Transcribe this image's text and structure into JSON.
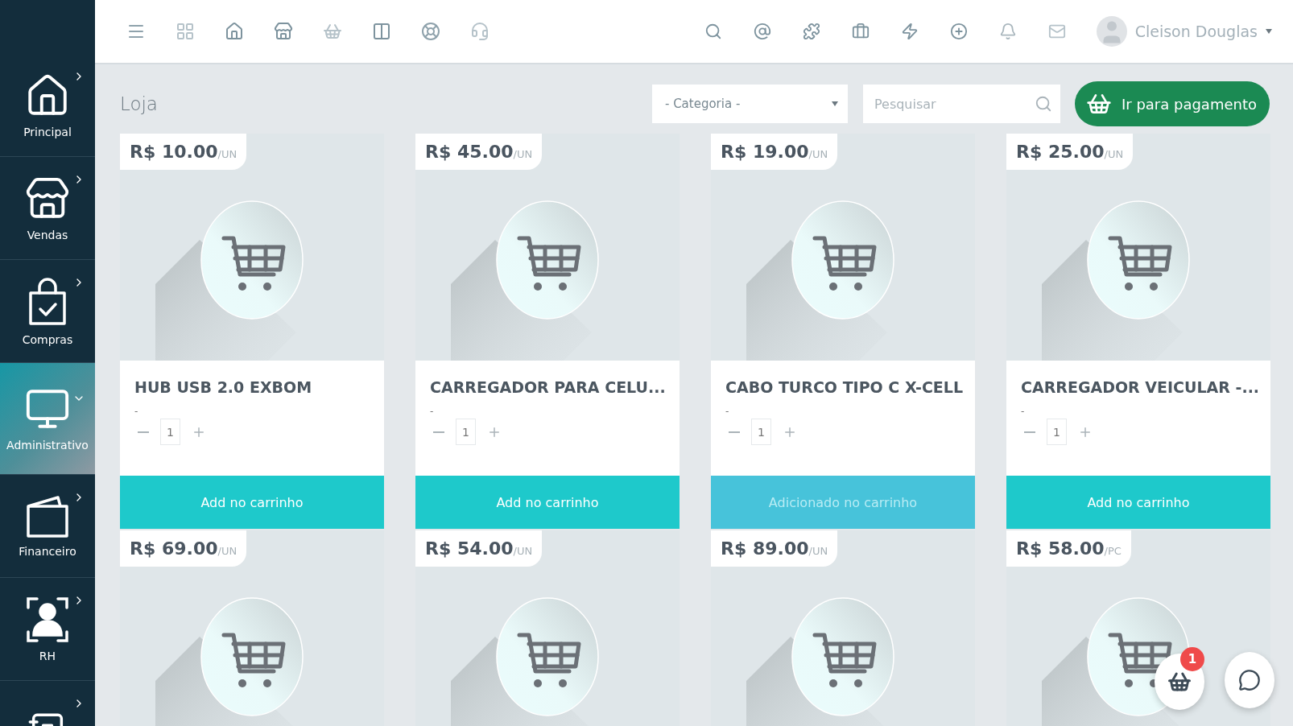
{
  "sidebar": {
    "items": [
      {
        "label": "Principal",
        "selected": false,
        "expanded": false
      },
      {
        "label": "Vendas",
        "selected": false,
        "expanded": false
      },
      {
        "label": "Compras",
        "selected": false,
        "expanded": false
      },
      {
        "label": "Administrativo",
        "selected": true,
        "expanded": true
      },
      {
        "label": "Financeiro",
        "selected": false,
        "expanded": false
      },
      {
        "label": "RH",
        "selected": false,
        "expanded": false
      },
      {
        "selected": false,
        "expanded": false
      }
    ]
  },
  "topbar": {
    "user": {
      "name": "Cleison Douglas"
    }
  },
  "page": {
    "title": "Loja",
    "category_select": {
      "value": "- Categoria -"
    },
    "search": {
      "placeholder": "Pesquisar"
    },
    "checkout_button": "Ir para pagamento"
  },
  "products": [
    {
      "price": "R$ 10.00",
      "unit": "/UN",
      "name": "HUB USB 2.0 EXBOM",
      "description": "-",
      "quantity": "1",
      "button": "Add no carrinho",
      "added": false
    },
    {
      "price": "R$ 45.00",
      "unit": "/UN",
      "name": "CARREGADOR PARA CELU...",
      "description": "-",
      "quantity": "1",
      "button": "Add no carrinho",
      "added": false
    },
    {
      "price": "R$ 19.00",
      "unit": "/UN",
      "name": "CABO TURCO TIPO C X-CELL",
      "description": "-",
      "quantity": "1",
      "button": "Adicionado no carrinho",
      "added": true
    },
    {
      "price": "R$ 25.00",
      "unit": "/UN",
      "name": "CARREGADOR VEICULAR -...",
      "description": "-",
      "quantity": "1",
      "button": "Add no carrinho",
      "added": false
    },
    {
      "price": "R$ 69.00",
      "unit": "/UN"
    },
    {
      "price": "R$ 54.00",
      "unit": "/UN"
    },
    {
      "price": "R$ 89.00",
      "unit": "/UN"
    },
    {
      "price": "R$ 58.00",
      "unit": "/PC"
    }
  ],
  "floating": {
    "cart_badge": "1"
  }
}
